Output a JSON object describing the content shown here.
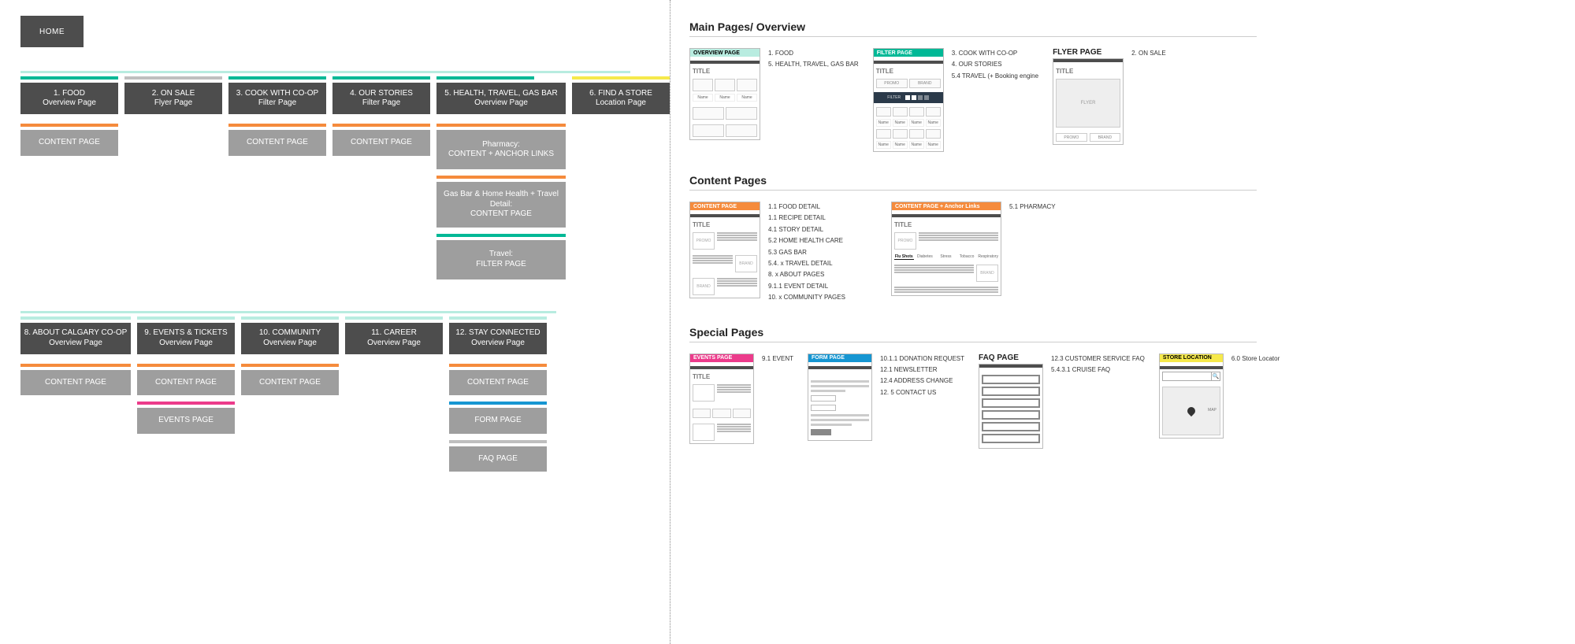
{
  "home": {
    "label": "HOME"
  },
  "sitemap": {
    "row1": [
      {
        "cap": "teal",
        "title": "1. FOOD",
        "subtitle": "Overview Page",
        "children": [
          {
            "cap": "orange",
            "label": "CONTENT PAGE"
          }
        ]
      },
      {
        "cap": "gray",
        "title": "2. ON SALE",
        "subtitle": "Flyer Page",
        "children": []
      },
      {
        "cap": "teal",
        "title": "3. COOK WITH CO-OP",
        "subtitle": "Filter Page",
        "children": [
          {
            "cap": "orange",
            "label": "CONTENT PAGE"
          }
        ]
      },
      {
        "cap": "teal",
        "title": "4. OUR STORIES",
        "subtitle": "Filter Page",
        "children": [
          {
            "cap": "orange",
            "label": "CONTENT PAGE"
          }
        ]
      },
      {
        "cap": "teal",
        "title": "5. HEALTH, TRAVEL, GAS BAR",
        "subtitle": "Overview Page",
        "children": [
          {
            "cap": "orange",
            "label": "Pharmacy:",
            "sub": "CONTENT + ANCHOR LINKS"
          },
          {
            "cap": "orange",
            "label": "Gas Bar & Home Health + Travel Detail:",
            "sub": "CONTENT PAGE"
          },
          {
            "cap": "teal",
            "label": "Travel:",
            "sub": "FILTER PAGE"
          }
        ]
      },
      {
        "cap": "yellow",
        "title": "6. FIND A STORE",
        "subtitle": "Location Page",
        "children": []
      }
    ],
    "row2": [
      {
        "cap": "mint",
        "title": "8. ABOUT CALGARY CO-OP",
        "subtitle": "Overview Page",
        "children": [
          {
            "cap": "orange",
            "label": "CONTENT PAGE"
          }
        ]
      },
      {
        "cap": "mint",
        "title": "9. EVENTS & TICKETS",
        "subtitle": "Overview Page",
        "children": [
          {
            "cap": "orange",
            "label": "CONTENT PAGE"
          },
          {
            "cap": "pink",
            "label": "EVENTS PAGE"
          }
        ]
      },
      {
        "cap": "mint",
        "title": "10. COMMUNITY",
        "subtitle": "Overview Page",
        "children": [
          {
            "cap": "orange",
            "label": "CONTENT PAGE"
          }
        ]
      },
      {
        "cap": "mint",
        "title": "11. CAREER",
        "subtitle": "Overview Page",
        "children": []
      },
      {
        "cap": "mint",
        "title": "12. STAY CONNECTED",
        "subtitle": "Overview Page",
        "children": [
          {
            "cap": "orange",
            "label": "CONTENT PAGE"
          },
          {
            "cap": "blue",
            "label": "FORM PAGE"
          },
          {
            "cap": "gray",
            "label": "FAQ PAGE"
          }
        ]
      }
    ]
  },
  "legend": {
    "sections": {
      "main": {
        "title": "Main Pages/ Overview"
      },
      "content": {
        "title": "Content Pages"
      },
      "special": {
        "title": "Special Pages"
      }
    },
    "overview_page": {
      "header": "OVERVIEW PAGE",
      "cap": "mint",
      "title": "TITLE",
      "list": [
        "1. FOOD",
        "5. HEALTH, TRAVEL, GAS BAR"
      ],
      "chip_label": "Name"
    },
    "filter_page": {
      "header": "FILTER PAGE",
      "cap": "teal",
      "title": "TITLE",
      "list": [
        "3. COOK WITH CO-OP",
        "4. OUR STORIES",
        "5.4 TRAVEL  (+ Booking engine"
      ],
      "chip_a": "PROMO",
      "chip_b": "BRAND",
      "filter_label": "FILTER",
      "name_label": "Name"
    },
    "flyer_page": {
      "header": "FLYER PAGE",
      "title": "TITLE",
      "list": [
        "2. ON SALE"
      ],
      "flyer_label": "FLYER",
      "btn_a": "PROMO",
      "btn_b": "BRAND"
    },
    "content_page": {
      "header": "CONTENT PAGE",
      "cap": "orange",
      "title": "TITLE",
      "chip_a": "PROMO",
      "chip_b": "BRAND",
      "list": [
        "1.1 FOOD  DETAIL",
        "1.1 RECIPE  DETAIL",
        "4.1 STORY  DETAIL",
        "5.2 HOME HEALTH CARE",
        "5.3 GAS BAR",
        "5.4. x TRAVEL DETAIL",
        "8. x ABOUT PAGES",
        "9.1.1 EVENT DETAIL",
        "10. x COMMUNITY PAGES"
      ]
    },
    "content_anchor": {
      "header": "CONTENT PAGE + Anchor Links",
      "cap": "orange",
      "title": "TITLE",
      "tabs": [
        "Flu Shots",
        "Diabetes",
        "Stress",
        "Tobacco",
        "Respiratory"
      ],
      "list": [
        "5.1 PHARMACY"
      ],
      "chip_a": "PROMO",
      "chip_b": "BRAND"
    },
    "events_page": {
      "header": "EVENTS PAGE",
      "cap": "pink",
      "title": "TITLE",
      "list": [
        "9.1 EVENT"
      ]
    },
    "form_page": {
      "header": "FORM PAGE",
      "cap": "blue",
      "title": "",
      "list": [
        "10.1.1 DONATION REQUEST",
        "12.1 NEWSLETTER",
        "12.4 ADDRESS CHANGE",
        "12. 5 CONTACT US"
      ]
    },
    "faq_page": {
      "header": "FAQ PAGE",
      "cap": "gray",
      "title": "",
      "list": [
        "12.3 CUSTOMER SERVICE FAQ",
        "5.4.3.1 CRUISE FAQ"
      ]
    },
    "store_location": {
      "header": "STORE LOCATION",
      "cap": "yellow",
      "title": "",
      "map_label": "MAP",
      "list": [
        "6.0 Store Locator"
      ],
      "search_icon": "🔍"
    }
  }
}
